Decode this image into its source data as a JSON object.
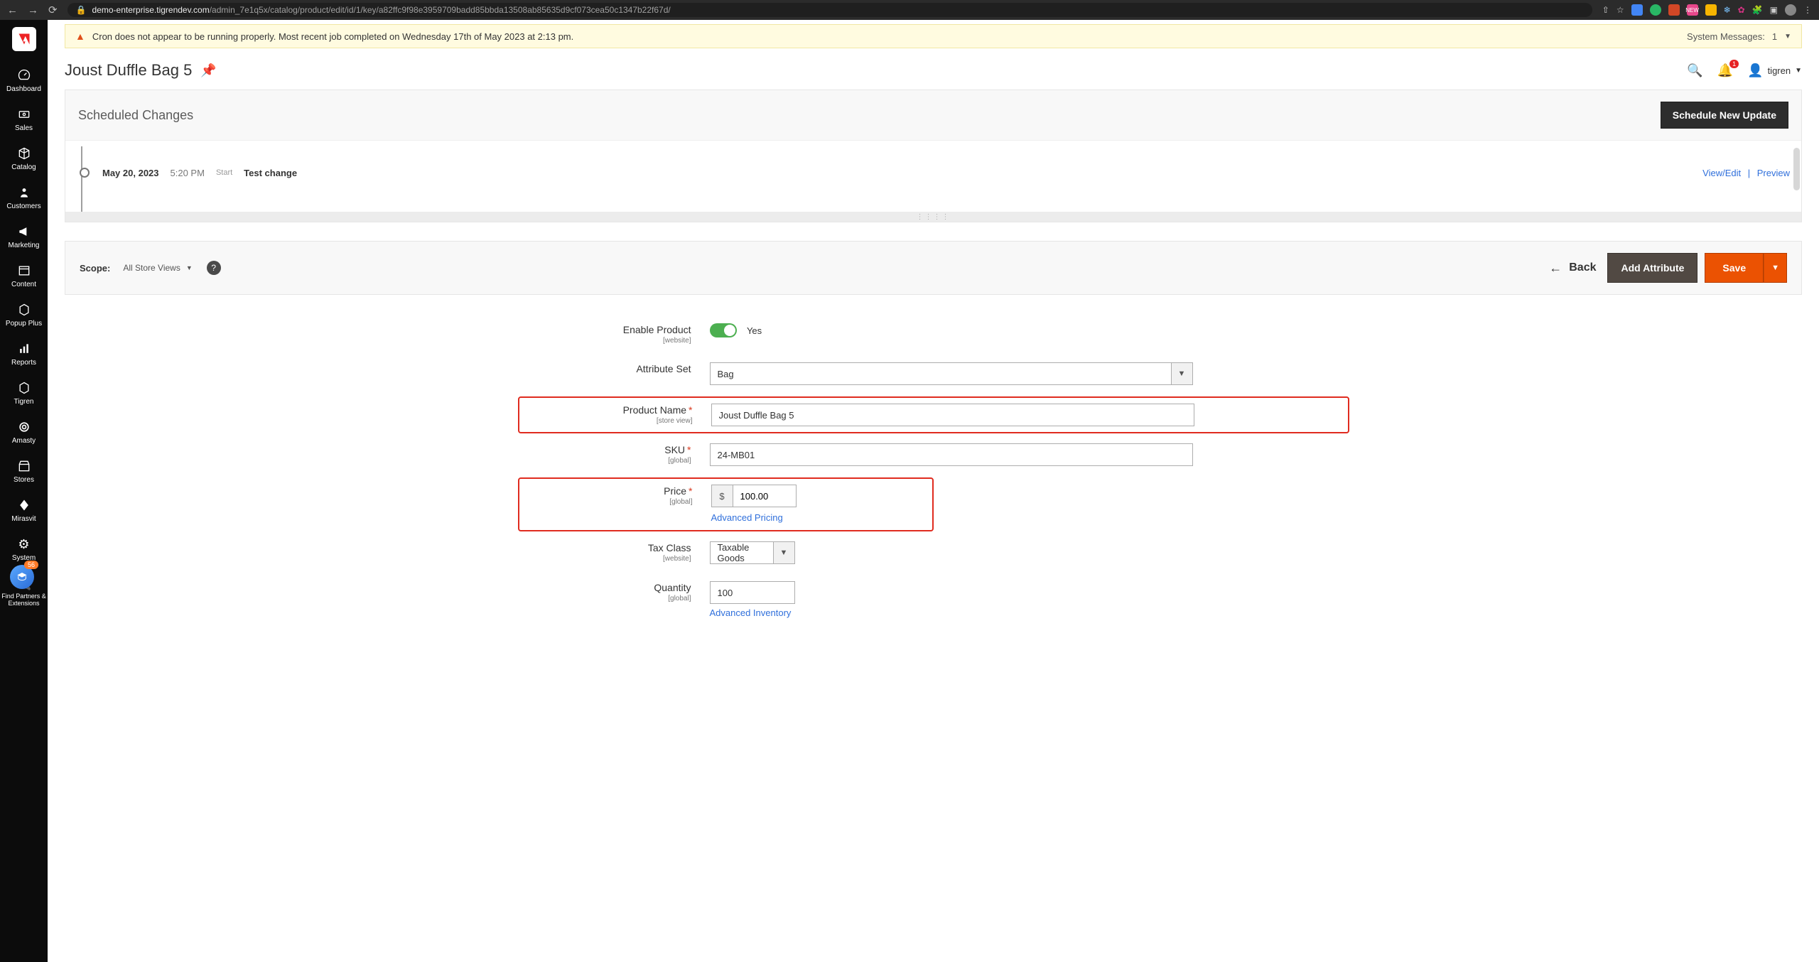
{
  "browser": {
    "url_host": "demo-enterprise.tigrendev.com",
    "url_path": "/admin_7e1q5x/catalog/product/edit/id/1/key/a82ffc9f98e3959709badd85bbda13508ab85635d9cf073cea50c1347b22f67d/"
  },
  "system_message": {
    "text": "Cron does not appear to be running properly. Most recent job completed on Wednesday 17th of May 2023 at 2:13 pm.",
    "right_label": "System Messages:",
    "count": "1"
  },
  "sidebar": {
    "items": [
      {
        "label": "Dashboard",
        "icon": "◉"
      },
      {
        "label": "Sales",
        "icon": "💵"
      },
      {
        "label": "Catalog",
        "icon": "⬢"
      },
      {
        "label": "Customers",
        "icon": "👥"
      },
      {
        "label": "Marketing",
        "icon": "📣"
      },
      {
        "label": "Content",
        "icon": "🗂"
      },
      {
        "label": "Popup Plus",
        "icon": "◯"
      },
      {
        "label": "Reports",
        "icon": "📊"
      },
      {
        "label": "Tigren",
        "icon": "◯"
      },
      {
        "label": "Amasty",
        "icon": "◎"
      },
      {
        "label": "Stores",
        "icon": "🏬"
      },
      {
        "label": "Mirasvit",
        "icon": "◈"
      },
      {
        "label": "System",
        "icon": "⚙"
      },
      {
        "label": "Find Partners & Extensions",
        "icon": "🔌"
      }
    ],
    "fab_badge": "56"
  },
  "header": {
    "title": "Joust Duffle Bag 5",
    "notifications": "1",
    "username": "tigren"
  },
  "scheduled": {
    "heading": "Scheduled Changes",
    "new_btn": "Schedule New Update",
    "entry": {
      "date": "May 20, 2023",
      "time": "5:20 PM",
      "start": "Start",
      "title": "Test change"
    },
    "links": {
      "view": "View/Edit",
      "preview": "Preview"
    }
  },
  "scope_bar": {
    "label": "Scope:",
    "value": "All Store Views",
    "back": "Back",
    "add_attr": "Add Attribute",
    "save": "Save"
  },
  "form": {
    "enable": {
      "label": "Enable Product",
      "hint": "[website]",
      "value": "Yes"
    },
    "attr_set": {
      "label": "Attribute Set",
      "value": "Bag"
    },
    "name": {
      "label": "Product Name",
      "hint": "[store view]",
      "value": "Joust Duffle Bag 5"
    },
    "sku": {
      "label": "SKU",
      "hint": "[global]",
      "value": "24-MB01"
    },
    "price": {
      "label": "Price",
      "hint": "[global]",
      "currency": "$",
      "value": "100.00",
      "link": "Advanced Pricing"
    },
    "tax": {
      "label": "Tax Class",
      "hint": "[website]",
      "value": "Taxable Goods"
    },
    "qty": {
      "label": "Quantity",
      "hint": "[global]",
      "value": "100",
      "link": "Advanced Inventory"
    }
  }
}
